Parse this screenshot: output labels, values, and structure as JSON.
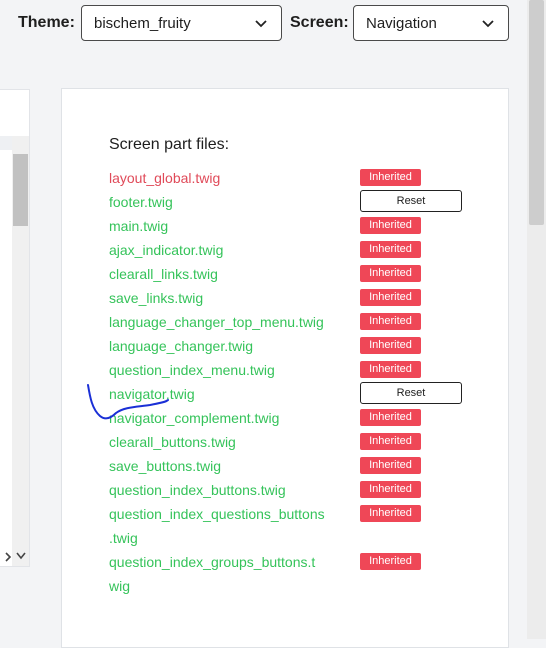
{
  "topbar": {
    "theme_label": "Theme:",
    "theme_value": "bischem_fruity",
    "screen_label": "Screen:",
    "screen_value": "Navigation"
  },
  "icons": {
    "dropdown": "chevron-down-icon",
    "scroll_up": "arrow-up-icon",
    "scroll_down": "arrow-down-icon",
    "scroll_right": "arrow-right-icon"
  },
  "card": {
    "title": "Screen part files:",
    "files": [
      {
        "name": "layout_global.twig",
        "status": "Inherited"
      },
      {
        "name": "footer.twig",
        "status": "Reset"
      },
      {
        "name": "main.twig",
        "status": "Inherited"
      },
      {
        "name": "ajax_indicator.twig",
        "status": "Inherited"
      },
      {
        "name": "clearall_links.twig",
        "status": "Inherited"
      },
      {
        "name": "save_links.twig",
        "status": "Inherited"
      },
      {
        "name": "language_changer_top_menu.twig",
        "status": "Inherited"
      },
      {
        "name": "language_changer.twig",
        "status": "Inherited"
      },
      {
        "name": "question_index_menu.twig",
        "status": "Inherited"
      },
      {
        "name": "navigator.twig",
        "status": "Reset"
      },
      {
        "name": "navigator_complement.twig",
        "status": "Inherited"
      },
      {
        "name": "clearall_buttons.twig",
        "status": "Inherited"
      },
      {
        "name": "save_buttons.twig",
        "status": "Inherited"
      },
      {
        "name": "question_index_buttons.twig",
        "status": "Inherited"
      },
      {
        "name_line1": "question_index_questions_buttons",
        "name_line2": ".twig",
        "status": "Inherited"
      },
      {
        "name_line1": "question_index_groups_buttons.t",
        "name_line2": "wig",
        "status": "Inherited"
      }
    ]
  },
  "colors": {
    "file_green": "#35c35a",
    "file_red": "#e04a59",
    "badge_red": "#ef4757",
    "scribble_blue": "#1a2fd6"
  }
}
